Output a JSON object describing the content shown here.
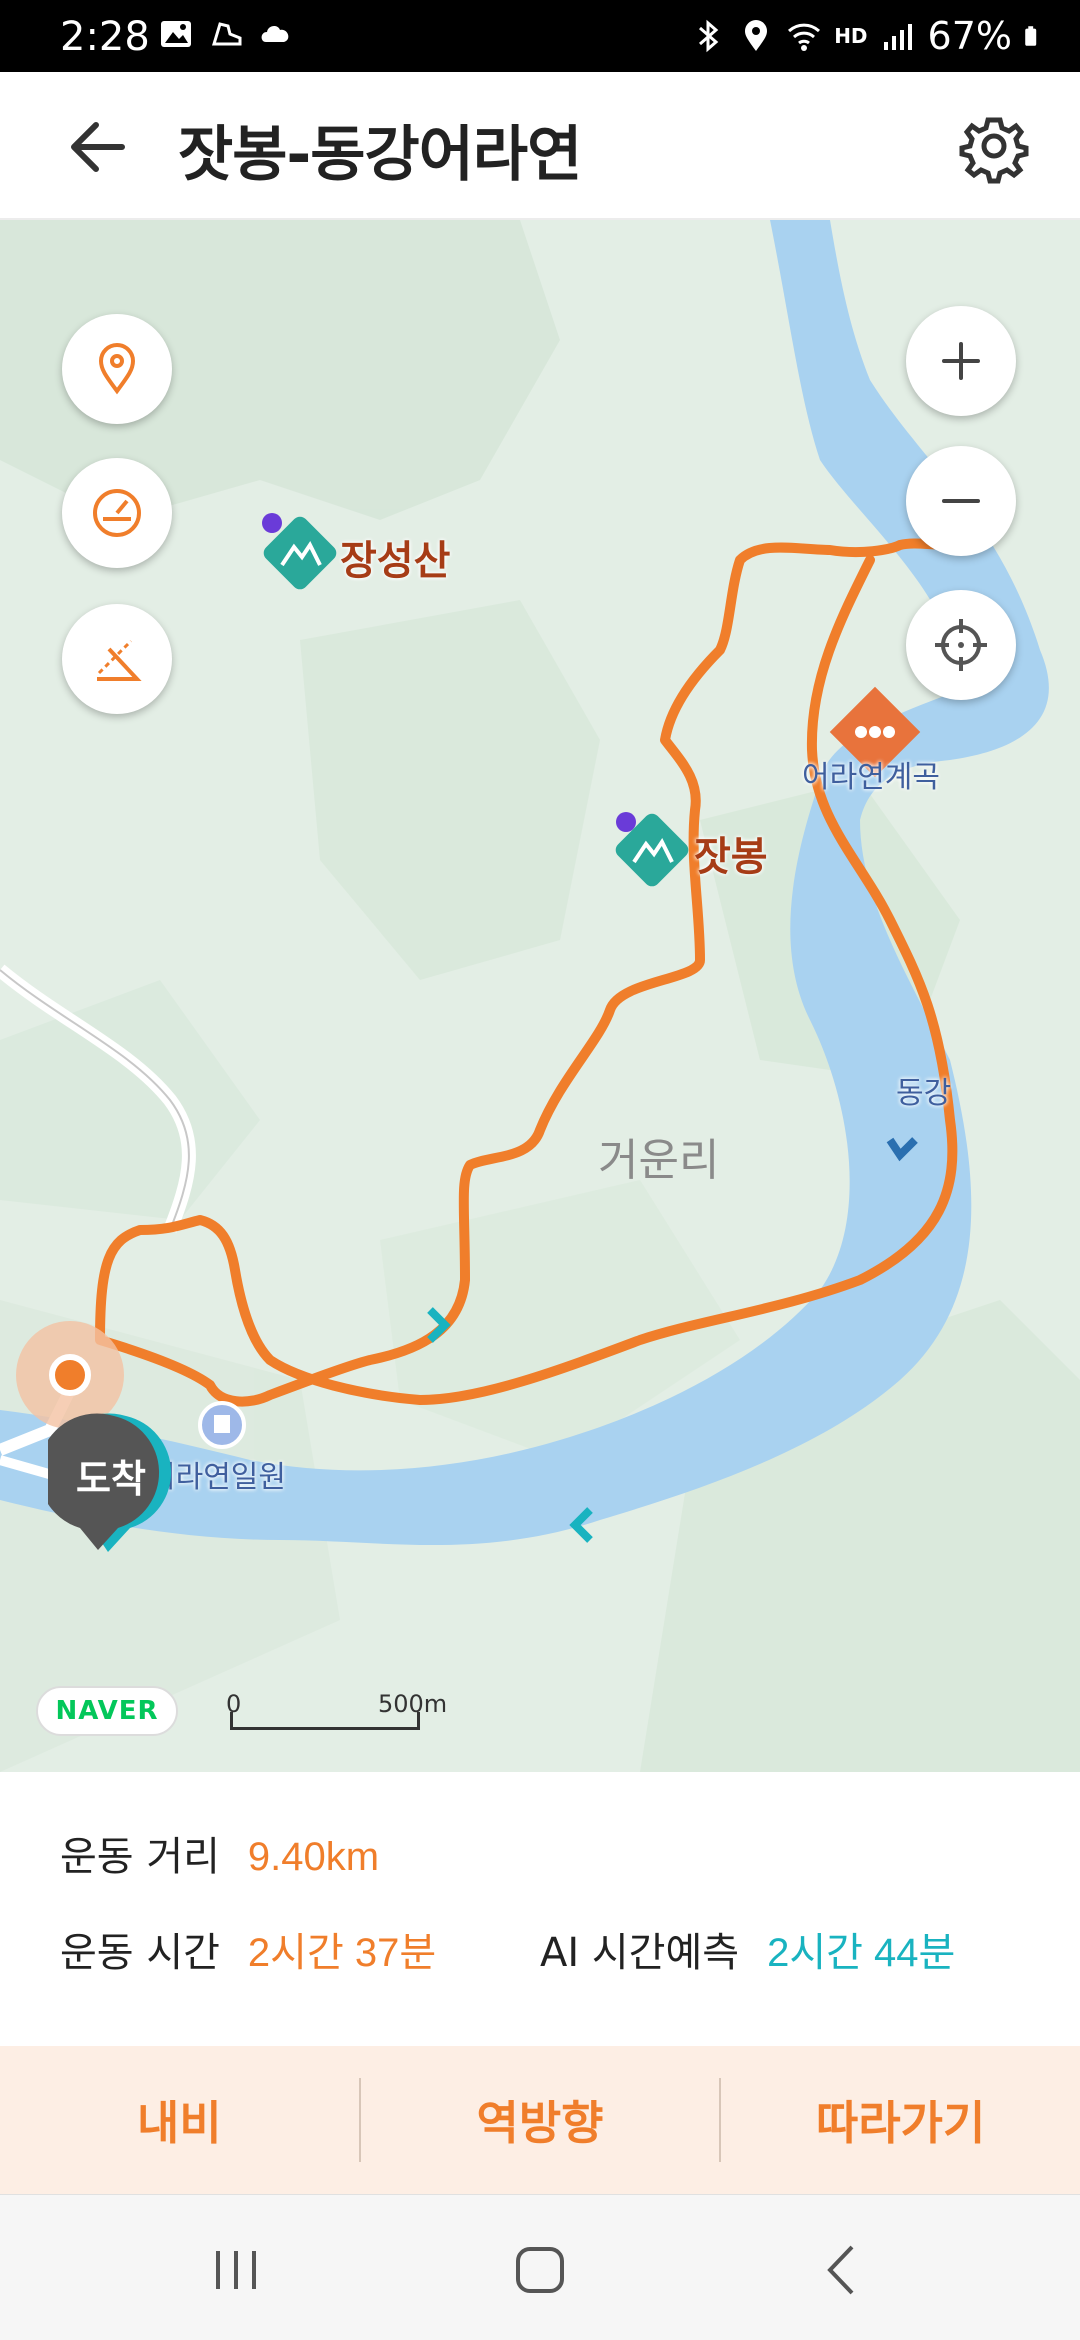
{
  "status_bar": {
    "time": "2:28",
    "battery": "67%",
    "icons": [
      "gallery-icon",
      "shoe-icon",
      "cloud-icon",
      "bluetooth-icon",
      "location-icon",
      "wifi-icon",
      "hd-voice-icon",
      "signal-icon",
      "battery-icon"
    ],
    "hd_label": "HD"
  },
  "header": {
    "title": "잣봉-동강어라연"
  },
  "map": {
    "pois": [
      {
        "name": "장성산"
      },
      {
        "name": "잣봉"
      }
    ],
    "places": {
      "valley": "어라연계곡",
      "river": "동강",
      "area": "거운리",
      "lodge": "어라연일원"
    },
    "arrive_label": "도착",
    "naver": "NAVER",
    "scale_start": "0",
    "scale_end": "500m",
    "colors": {
      "route": "#f07e2b",
      "river": "#a9d2f0",
      "land": "#e3eee5",
      "poi": "#2aa89a"
    }
  },
  "info": {
    "distance_label": "운동 거리",
    "distance_value": "9.40km",
    "time_label": "운동 시간",
    "time_value": "2시간 37분",
    "ai_label": "AI 시간예측",
    "ai_value": "2시간 44분"
  },
  "actions": {
    "navi": "내비",
    "reverse": "역방향",
    "follow": "따라가기"
  }
}
